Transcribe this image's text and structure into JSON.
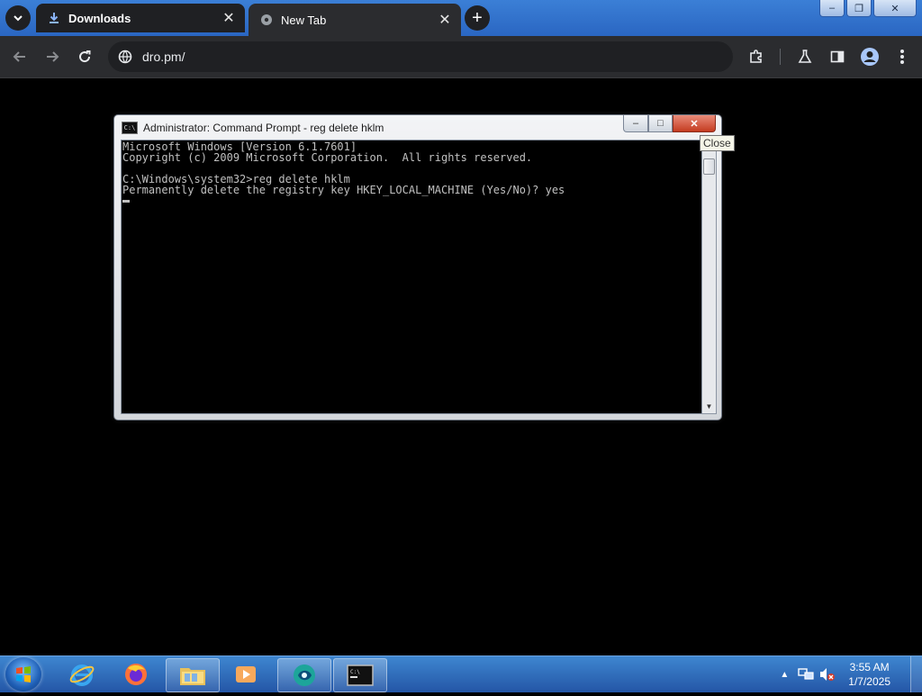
{
  "browser": {
    "tabs": [
      {
        "label": "Downloads",
        "icon": "download-icon",
        "active": true
      },
      {
        "label": "New Tab",
        "icon": "globe-icon",
        "active": false
      }
    ],
    "address": "dro.pm/"
  },
  "cmd": {
    "title": "Administrator: Command Prompt - reg  delete hklm",
    "console_lines": [
      "Microsoft Windows [Version 6.1.7601]",
      "Copyright (c) 2009 Microsoft Corporation.  All rights reserved.",
      "",
      "C:\\Windows\\system32>reg delete hklm",
      "Permanently delete the registry key HKEY_LOCAL_MACHINE (Yes/No)? yes"
    ],
    "close_tooltip": "Close",
    "min_glyph": "–",
    "max_glyph": "□",
    "close_glyph": "✕"
  },
  "taskbar": {
    "time": "3:55 AM",
    "date": "1/7/2025",
    "apps": [
      "internet-explorer",
      "firefox",
      "file-explorer",
      "media-player",
      "rufus-like-app",
      "command-prompt"
    ]
  },
  "colors": {
    "chrome_frame": "#2a66c2",
    "chrome_tab_active": "#1f2023",
    "console_text": "#c0c0c0",
    "close_red": "#c43c21"
  }
}
